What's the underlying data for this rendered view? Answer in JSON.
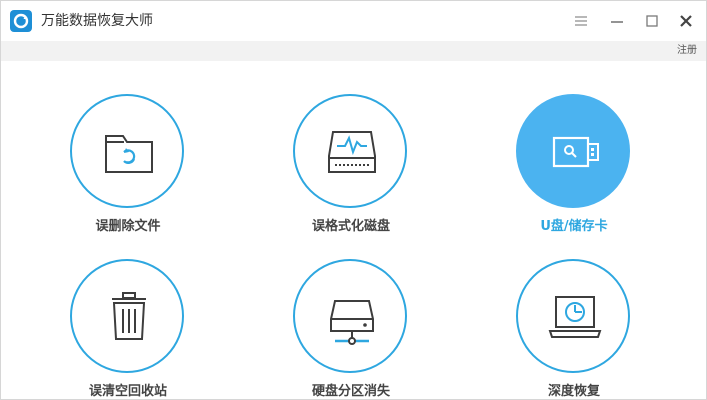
{
  "window": {
    "title": "万能数据恢复大师",
    "register_label": "注册"
  },
  "colors": {
    "accent": "#2ea7e0",
    "active_fill": "#4bb3f0",
    "label_text": "#444444",
    "subbar_bg": "#f2f2f2"
  },
  "tiles": [
    {
      "label": "误删除文件",
      "icon": "folder-recycle-icon",
      "active": false
    },
    {
      "label": "误格式化磁盘",
      "icon": "disk-pulse-icon",
      "active": false
    },
    {
      "label": "U盘/储存卡",
      "icon": "usb-drive-icon",
      "active": true
    },
    {
      "label": "误清空回收站",
      "icon": "trash-bin-icon",
      "active": false
    },
    {
      "label": "硬盘分区消失",
      "icon": "network-drive-icon",
      "active": false
    },
    {
      "label": "深度恢复",
      "icon": "laptop-scan-icon",
      "active": false
    }
  ]
}
